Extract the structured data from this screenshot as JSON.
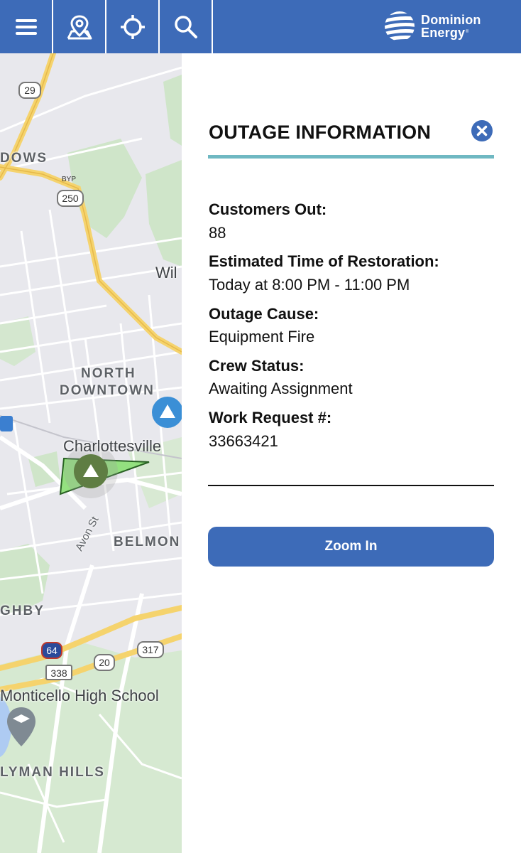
{
  "toolbar": {
    "menu_icon": "menu-icon",
    "pin_icon": "map-pin-icon",
    "locate_icon": "crosshair-icon",
    "search_icon": "search-icon",
    "brand_line1": "Dominion",
    "brand_line2": "Energy",
    "brand_reg": "®",
    "color": "#3d6bb8"
  },
  "map": {
    "labels": {
      "dows": "DOWS",
      "north": "NORTH",
      "downtown": "DOWNTOWN",
      "charlottesville": "Charlottesville",
      "belmont": "BELMON",
      "ghby": "GHBY",
      "monticello": "Monticello High School",
      "lyman": "LYMAN HILLS",
      "wil": "Wil",
      "avon": "Avon St"
    },
    "shields": {
      "us29": "29",
      "byp": "BYP",
      "us250": "250",
      "i64": "64",
      "r338": "338",
      "r20": "20",
      "r317": "317"
    }
  },
  "panel": {
    "title": "OUTAGE INFORMATION",
    "close_icon": "close-icon",
    "accent_color": "#6fb8c2",
    "fields": [
      {
        "label": "Customers Out:",
        "value": "88"
      },
      {
        "label": "Estimated Time of Restoration:",
        "value": "Today at 8:00 PM - 11:00 PM"
      },
      {
        "label": "Outage Cause:",
        "value": "Equipment Fire"
      },
      {
        "label": "Crew Status:",
        "value": "Awaiting Assignment"
      },
      {
        "label": "Work Request #:",
        "value": "33663421"
      }
    ],
    "zoom_label": "Zoom In"
  }
}
